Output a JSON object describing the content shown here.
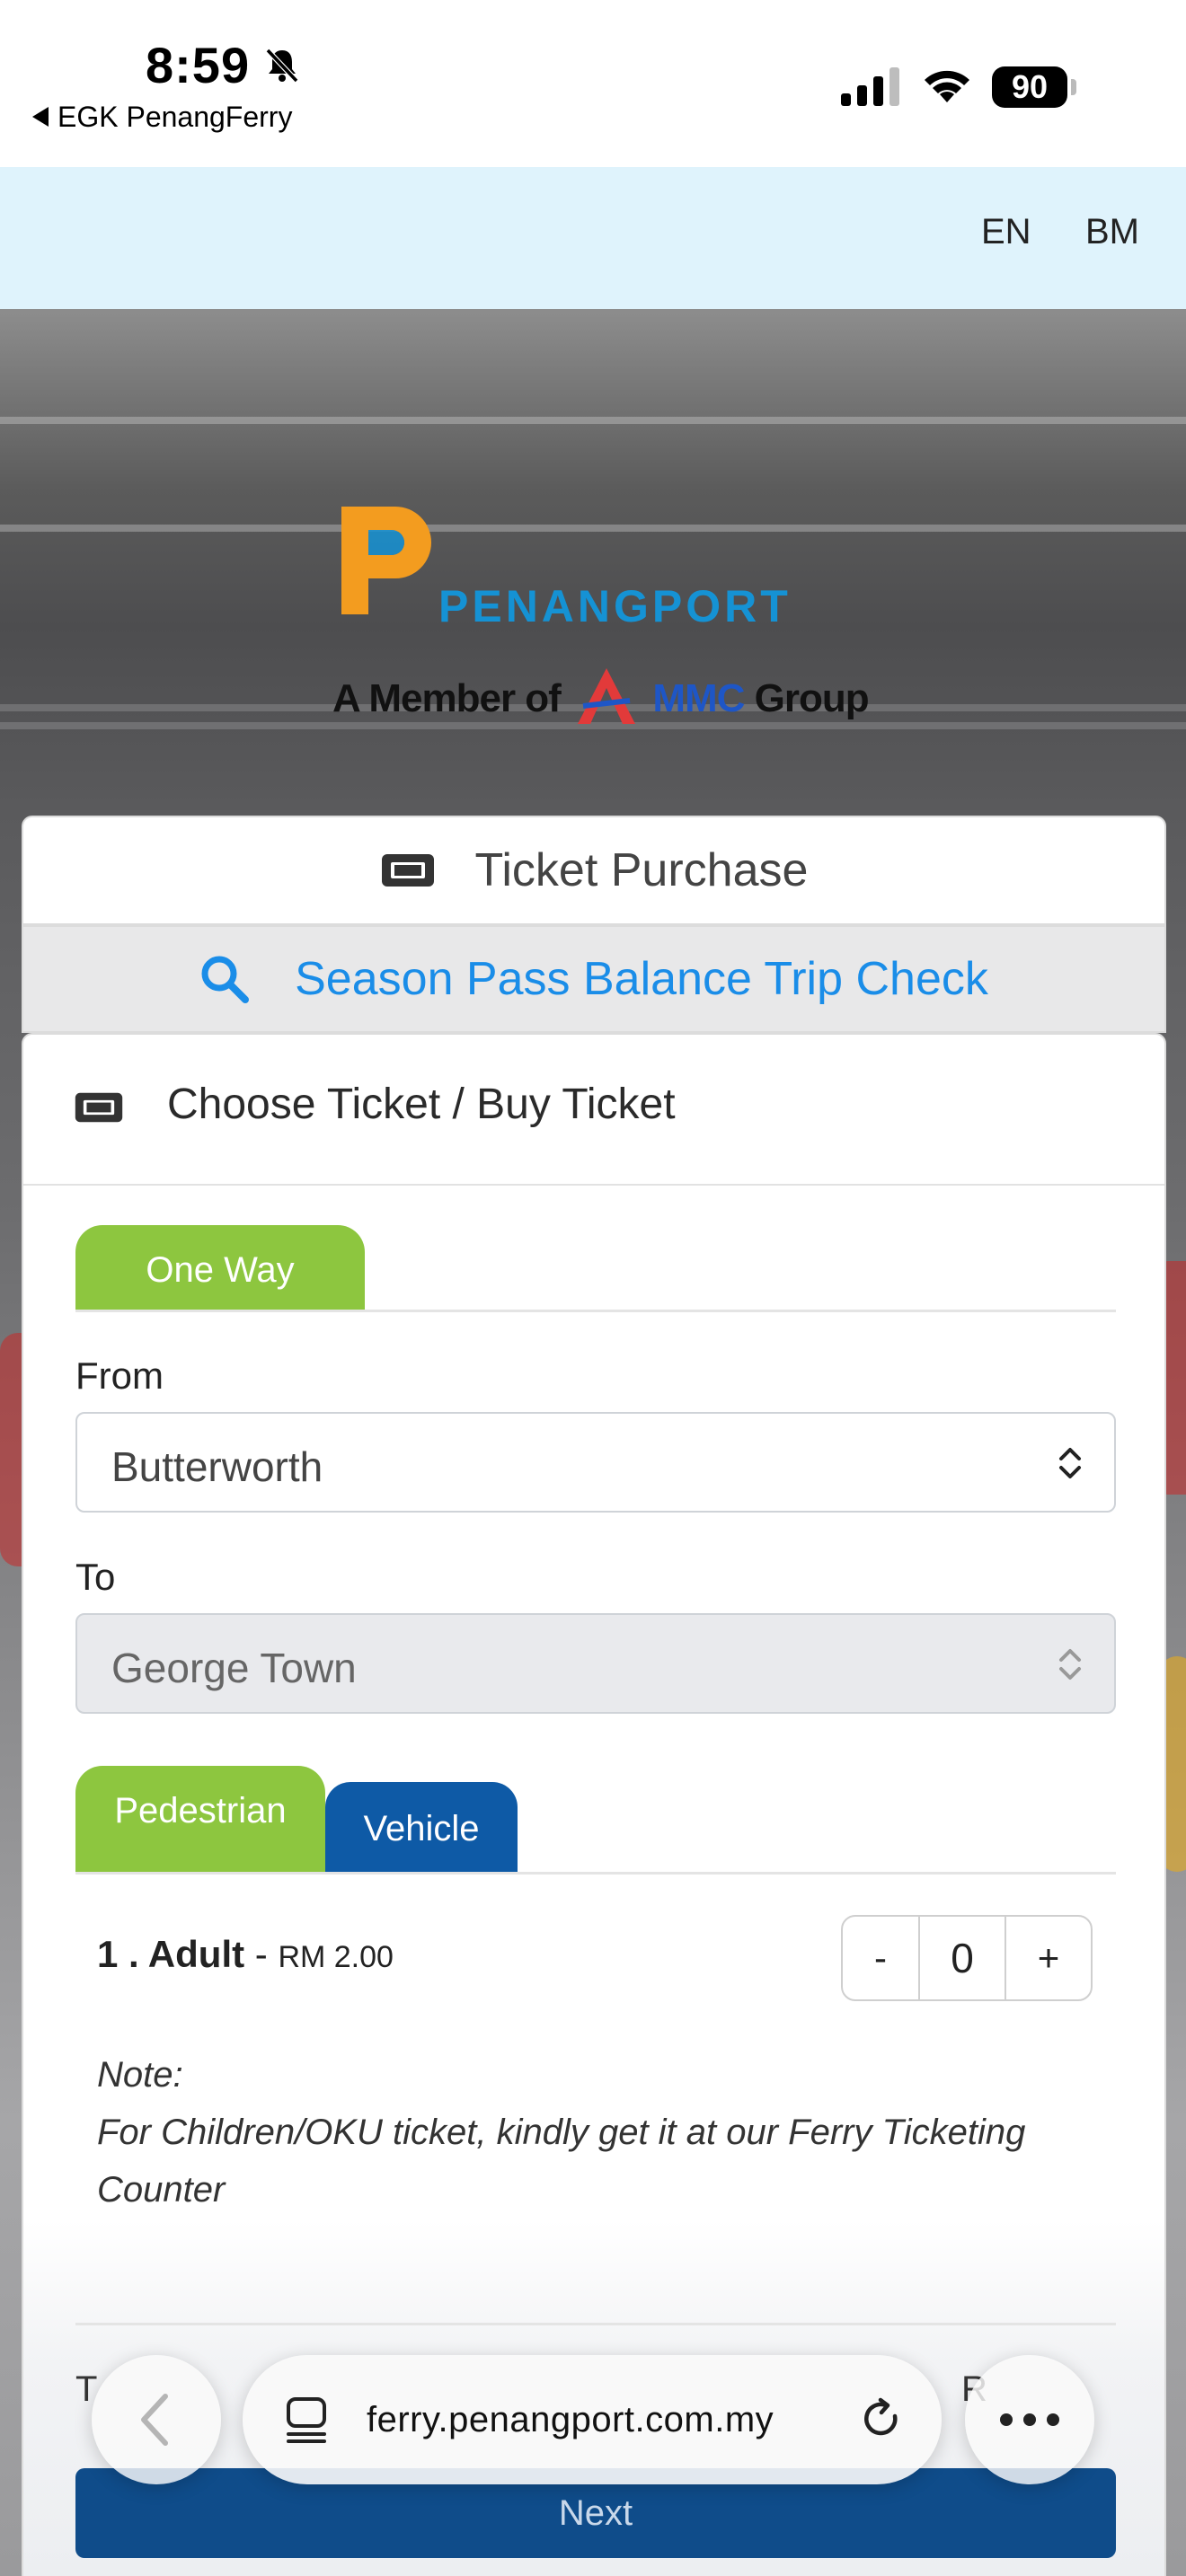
{
  "status_bar": {
    "time": "8:59",
    "back_app": "EGK PenangFerry",
    "battery": "90"
  },
  "language": {
    "en": "EN",
    "bm": "BM"
  },
  "logo": {
    "brand": "PENANGPORT",
    "member_prefix": "A Member of",
    "group_name": "MMC",
    "group_suffix": "Group"
  },
  "tabs": {
    "ticket_purchase": "Ticket Purchase",
    "season_pass": "Season Pass Balance Trip Check"
  },
  "form": {
    "header": "Choose Ticket / Buy Ticket",
    "trip_type": "One Way",
    "from_label": "From",
    "from_value": "Butterworth",
    "to_label": "To",
    "to_value": "George Town",
    "category_tabs": [
      "Pedestrian",
      "Vehicle"
    ],
    "fare": {
      "index_name": "1 . Adult",
      "sep": " - ",
      "price": "RM 2.00",
      "quantity": "0",
      "minus": "-",
      "plus": "+"
    },
    "note_title": "Note:",
    "note_body": "For Children/OKU ticket, kindly get it at our Ferry Ticketing Counter",
    "total_label": "T",
    "total_value": "R",
    "next": "Next"
  },
  "browser": {
    "url": "ferry.penangport.com.my"
  },
  "colors": {
    "green": "#8dc63f",
    "vehicle_blue": "#0e5aa6",
    "link_blue": "#1a8de8",
    "next_blue": "#0f4c8a",
    "lang_bar": "#dff3fc"
  }
}
